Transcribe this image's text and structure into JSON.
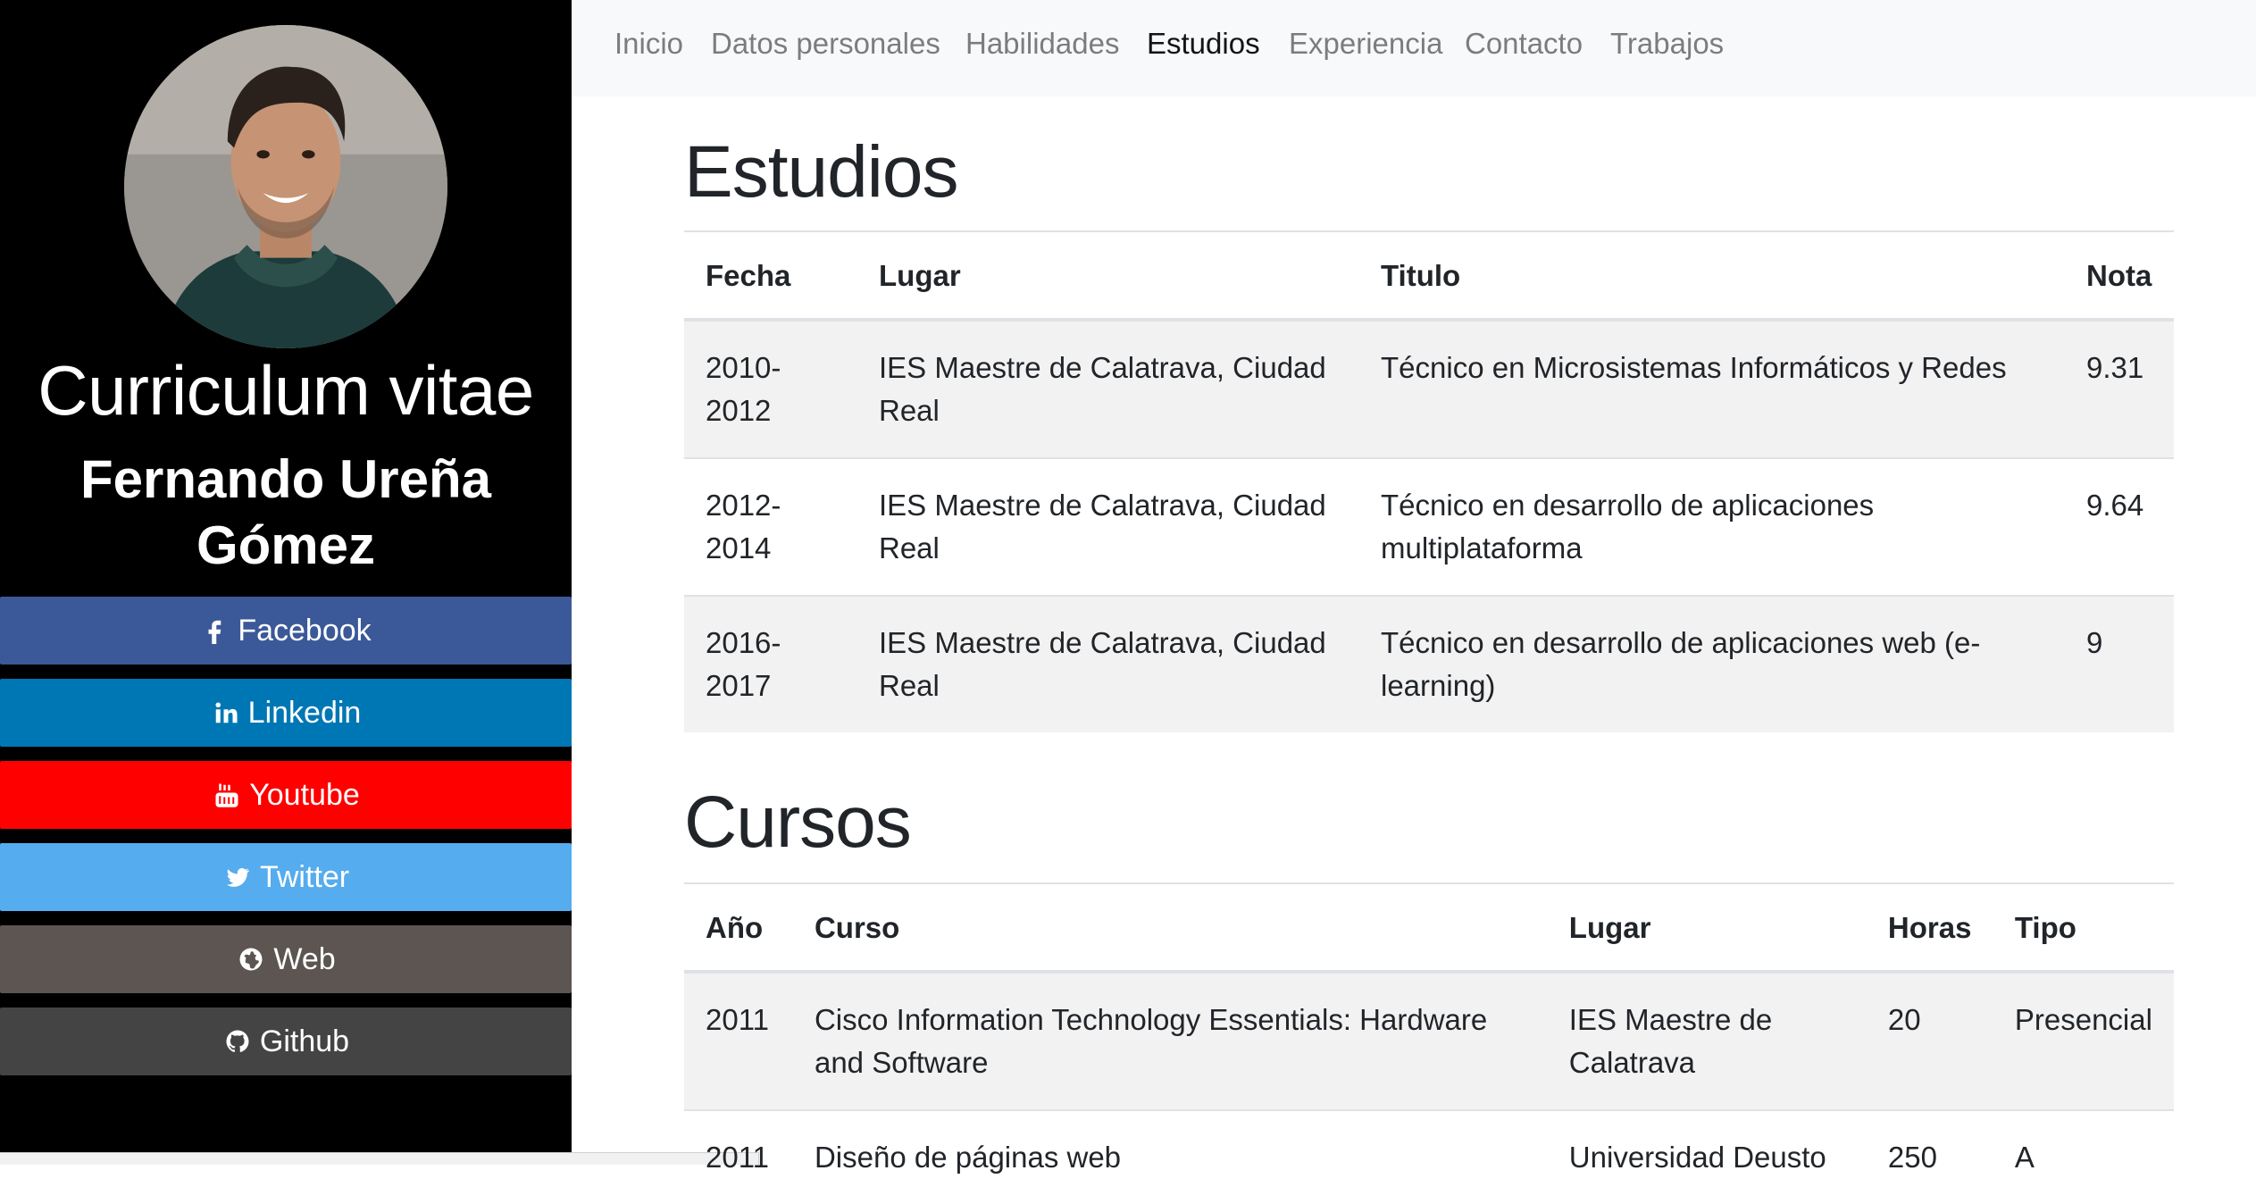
{
  "sidebar": {
    "title": "Curriculum vitae",
    "name": "Fernando Ureña Gómez",
    "social": [
      {
        "label": "Facebook",
        "icon": "facebook-icon",
        "color": "#3b5998"
      },
      {
        "label": "Linkedin",
        "icon": "linkedin-icon",
        "color": "#0077b5"
      },
      {
        "label": "Youtube",
        "icon": "youtube-icon",
        "color": "#ff0000"
      },
      {
        "label": "Twitter",
        "icon": "twitter-icon",
        "color": "#55acee"
      },
      {
        "label": "Web",
        "icon": "globe-icon",
        "color": "#5c5552"
      },
      {
        "label": "Github",
        "icon": "github-icon",
        "color": "#444444"
      }
    ]
  },
  "nav": {
    "items": [
      "Inicio",
      "Datos personales",
      "Habilidades",
      "Estudios",
      "Experiencia",
      "Contacto",
      "Trabajos"
    ],
    "active": "Estudios"
  },
  "estudios": {
    "heading": "Estudios",
    "headers": [
      "Fecha",
      "Lugar",
      "Titulo",
      "Nota"
    ],
    "rows": [
      [
        "2010-2012",
        "IES Maestre de Calatrava, Ciudad Real",
        "Técnico en Microsistemas Informáticos y Redes",
        "9.31"
      ],
      [
        "2012-2014",
        "IES Maestre de Calatrava, Ciudad Real",
        "Técnico en desarrollo de aplicaciones multiplataforma",
        "9.64"
      ],
      [
        "2016-2017",
        "IES Maestre de Calatrava, Ciudad Real",
        "Técnico en desarrollo de aplicaciones web (e-learning)",
        "9"
      ]
    ]
  },
  "cursos": {
    "heading": "Cursos",
    "headers": [
      "Año",
      "Curso",
      "Lugar",
      "Horas",
      "Tipo"
    ],
    "rows": [
      [
        "2011",
        "Cisco Information Technology Essentials: Hardware and Software",
        "IES Maestre de Calatrava",
        "20",
        "Presencial"
      ],
      [
        "2011",
        "Diseño de páginas web",
        "Universidad Deusto",
        "250",
        "A"
      ]
    ]
  }
}
